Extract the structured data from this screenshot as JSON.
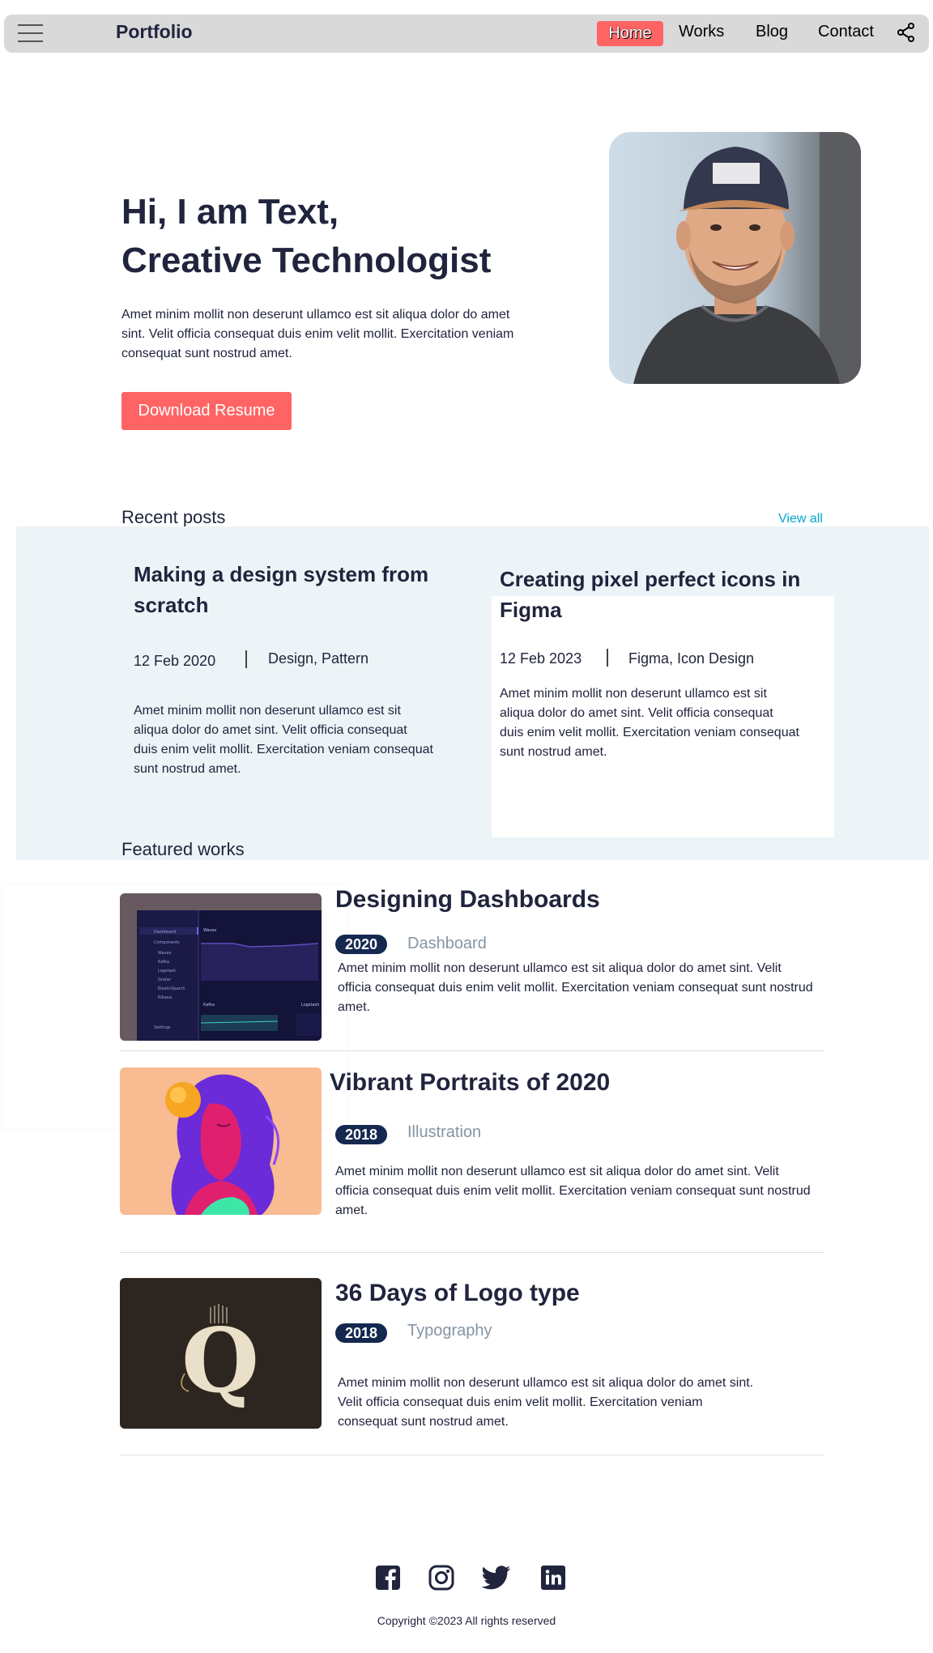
{
  "nav": {
    "brand": "Portfolio",
    "links": [
      "Home",
      "Works",
      "Blog",
      "Contact"
    ],
    "active": "Home",
    "menu_icon": "hamburger-icon",
    "share_icon": "share-icon"
  },
  "hero": {
    "title_line1": "Hi, I am Text,",
    "title_line2": "Creative Technologist",
    "description": "Amet minim mollit non deserunt ullamco est sit aliqua dolor do amet sint. Velit officia consequat duis enim velit mollit. Exercitation veniam consequat sunt nostrud amet.",
    "button": "Download Resume",
    "avatar_icon": "avatar-photo"
  },
  "recent_posts": {
    "heading": "Recent posts",
    "view_all": "View all",
    "posts": [
      {
        "title": "Making a design system from scratch",
        "date": "12 Feb 2020",
        "tags": "Design, Pattern",
        "body": "Amet minim mollit non deserunt ullamco est sit aliqua dolor do amet sint. Velit officia consequat duis enim velit mollit. Exercitation veniam consequat sunt nostrud amet."
      },
      {
        "title": "Creating pixel perfect icons in Figma",
        "date": "12 Feb 2023",
        "tags": "Figma, Icon Design",
        "body": "Amet minim mollit non deserunt ullamco est sit aliqua dolor do amet sint. Velit officia consequat duis enim velit mollit. Exercitation veniam consequat sunt nostrud amet."
      }
    ]
  },
  "featured_works": {
    "heading": "Featured works",
    "works": [
      {
        "title": "Designing Dashboards",
        "year": "2020",
        "category": "Dashboard",
        "body": "Amet minim mollit non deserunt ullamco est sit aliqua dolor do amet sint. Velit officia consequat duis enim velit mollit. Exercitation veniam consequat sunt nostrud amet.",
        "thumb_items": [
          "Dashboard",
          "Components",
          "Waves",
          "Kafka",
          "Logstash",
          "Grafar",
          "ElasticSearch",
          "Kibana",
          "Settings"
        ],
        "thumb_panels": [
          "Waves",
          "Kafka",
          "Logstash"
        ]
      },
      {
        "title": "Vibrant Portraits of 2020",
        "year": "2018",
        "category": "Illustration",
        "body": "Amet minim mollit non deserunt ullamco est sit aliqua dolor do amet sint. Velit officia consequat duis enim velit mollit. Exercitation veniam consequat sunt nostrud amet."
      },
      {
        "title": "36 Days of Logo type",
        "year": "2018",
        "category": "Typography",
        "body": "Amet minim mollit non deserunt ullamco est sit aliqua dolor do amet sint. Velit officia consequat duis enim velit mollit. Exercitation veniam consequat sunt nostrud amet.",
        "thumb_glyph": "Q"
      }
    ]
  },
  "footer": {
    "social_icons": [
      "facebook-icon",
      "instagram-icon",
      "twitter-icon",
      "linkedin-icon"
    ],
    "copyright": "Copyright ©2023 All rights reserved"
  },
  "colors": {
    "accent": "#ff6464",
    "text": "#21243d",
    "badge": "#142850",
    "muted": "#8695a4",
    "link": "#00a8cc",
    "band": "#edf4f7"
  }
}
